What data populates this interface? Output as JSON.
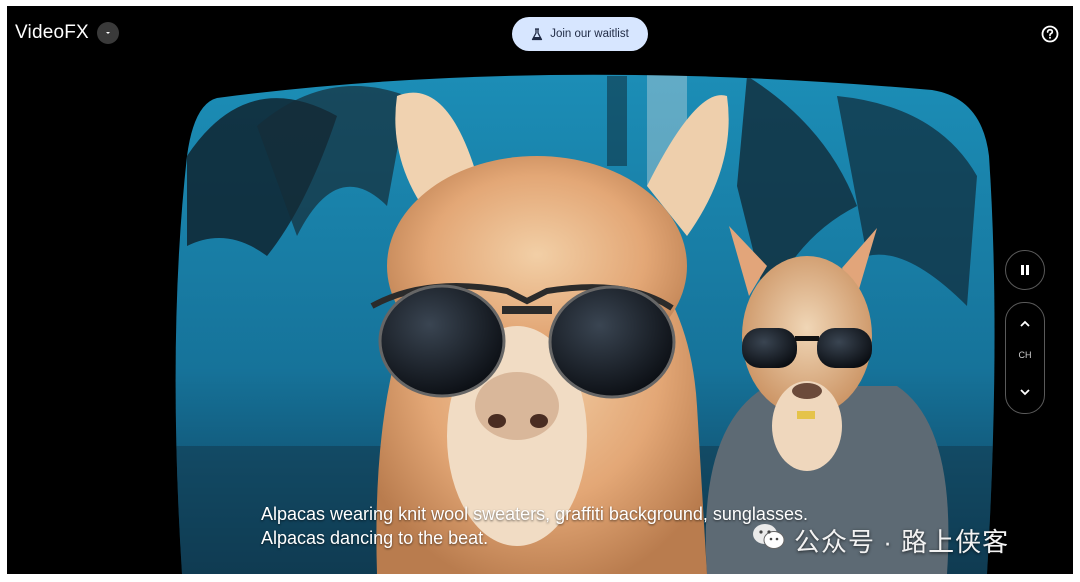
{
  "header": {
    "app_name": "VideoFX",
    "app_menu_icon": "chevron-down-icon",
    "waitlist_label": "Join our waitlist",
    "waitlist_icon": "flask-icon",
    "help_icon": "help-circle-icon"
  },
  "video": {
    "caption_line1": "Alpacas wearing knit wool sweaters, graffiti background, sunglasses.",
    "caption_line2": "Alpacas dancing to the beat.",
    "watermark_text": "公众号 · 路上侠客",
    "watermark_icon": "wechat-icon"
  },
  "controls": {
    "pause_icon": "pause-icon",
    "channel_label": "CH",
    "channel_up_icon": "chevron-up-icon",
    "channel_down_icon": "chevron-down-icon"
  },
  "colors": {
    "background": "#000000",
    "waitlist_button": "#d7e6ff",
    "graffiti_wall": "#1f7fa6"
  }
}
